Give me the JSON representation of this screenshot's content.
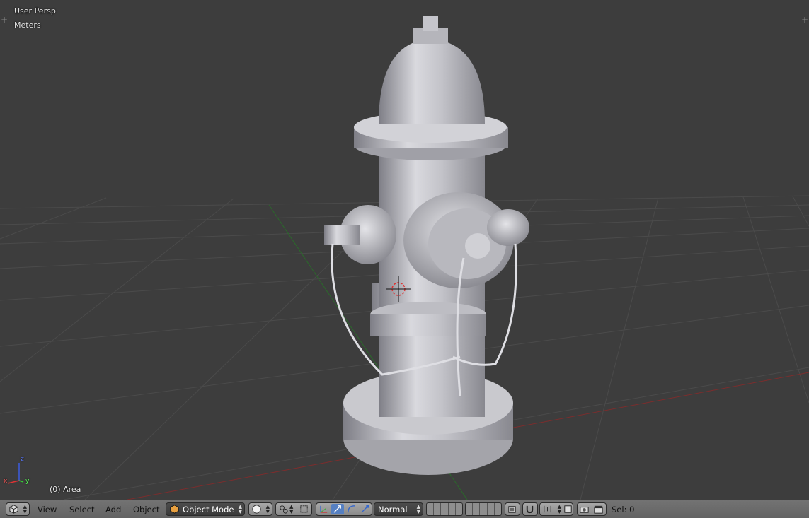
{
  "viewport": {
    "view_name": "User Persp",
    "units": "Meters",
    "object_label": "(0) Area",
    "axes": {
      "z": "z",
      "x": "x",
      "y": "y"
    }
  },
  "header": {
    "menus": [
      "View",
      "Select",
      "Add",
      "Object"
    ],
    "mode": "Object Mode",
    "orientation": "Normal",
    "selection": "Sel: 0"
  },
  "icons": {
    "editor_type": "cube-icon",
    "viewport_shading": "sphere-icon",
    "pivot": "pivot-icon",
    "manipulator": "manipulator-icon",
    "translate": "translate-icon",
    "rotate": "rotate-icon",
    "scale": "scale-icon",
    "layers": "layers-icon",
    "lock_camera": "lock-icon",
    "snap": "magnet-icon",
    "proportional": "proportional-icon",
    "render_opengl": "camera-icon",
    "render_anim": "clapper-icon"
  },
  "colors": {
    "background": "#3d3d3d",
    "grid": "#4a4a4a",
    "x_axis": "#8b2a2a",
    "y_axis": "#2a7a2a",
    "header": "#6b6b6b"
  }
}
